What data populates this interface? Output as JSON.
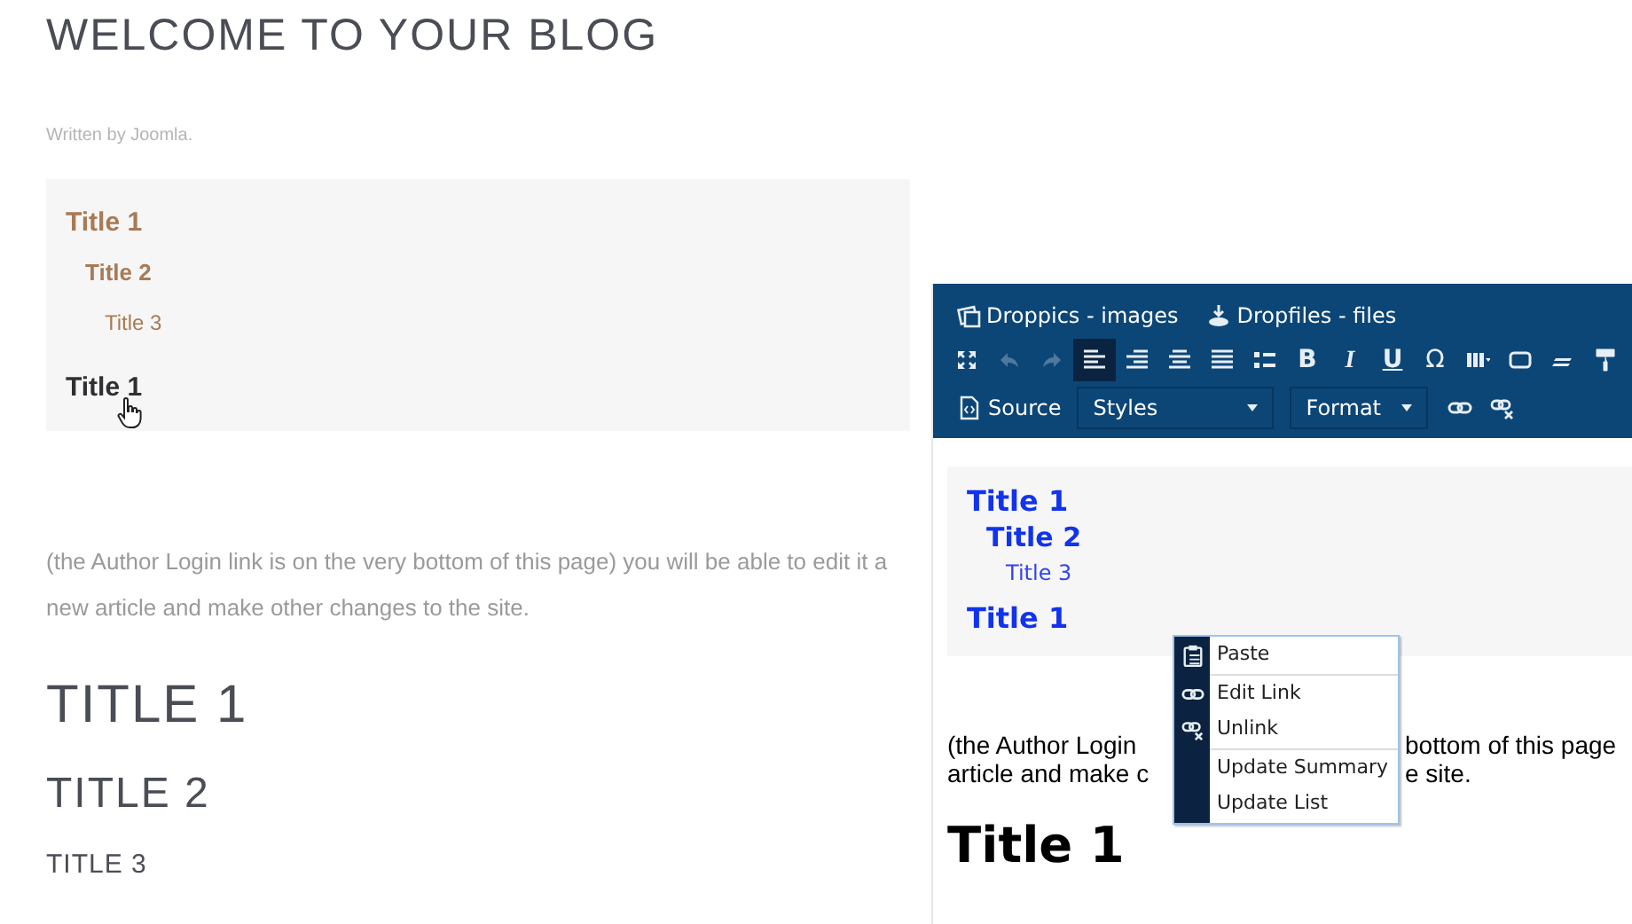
{
  "blog": {
    "title": "WELCOME TO YOUR BLOG",
    "byline": "Written by Joomla.",
    "toc": [
      {
        "text": "Title 1",
        "kind": "h1",
        "hovered": false
      },
      {
        "text": "Title 2",
        "kind": "h2",
        "hovered": false
      },
      {
        "text": "Title 3",
        "kind": "h3",
        "hovered": false
      },
      {
        "text": "Title 1",
        "kind": "h1",
        "hovered": true
      }
    ],
    "paragraph_lines": [
      "(the Author Login link is on the very bottom of this page) you will be able to edit it a",
      "new article and make other changes to the site."
    ],
    "headings": [
      {
        "text": "TITLE 1",
        "kind": "h1"
      },
      {
        "text": "TITLE 2",
        "kind": "h2"
      },
      {
        "text": "TITLE 3",
        "kind": "h3"
      }
    ]
  },
  "editor": {
    "plugins": [
      {
        "label": "Droppics - images",
        "kind": "images"
      },
      {
        "label": "Dropfiles - files",
        "kind": "files"
      }
    ],
    "toolbar": [
      {
        "kind": "fullscreen",
        "disabled": false,
        "selected": false
      },
      {
        "kind": "undo",
        "disabled": true,
        "selected": false
      },
      {
        "kind": "redo",
        "disabled": true,
        "selected": false
      },
      {
        "kind": "align-left",
        "disabled": false,
        "selected": true
      },
      {
        "kind": "align-right",
        "disabled": false,
        "selected": false
      },
      {
        "kind": "align-center",
        "disabled": false,
        "selected": false
      },
      {
        "kind": "justify",
        "disabled": false,
        "selected": false
      },
      {
        "kind": "bullet-list",
        "disabled": false,
        "selected": false
      },
      {
        "kind": "bold",
        "label": "B",
        "disabled": false,
        "selected": false
      },
      {
        "kind": "italic",
        "label": "I",
        "disabled": false,
        "selected": false
      },
      {
        "kind": "underline",
        "label": "U",
        "disabled": false,
        "selected": false
      },
      {
        "kind": "symbol",
        "label": "Ω",
        "disabled": false,
        "selected": false
      },
      {
        "kind": "table",
        "disabled": false,
        "selected": false
      },
      {
        "kind": "frame",
        "disabled": false,
        "selected": false
      },
      {
        "kind": "slash",
        "disabled": false,
        "selected": false
      },
      {
        "kind": "roller",
        "disabled": false,
        "selected": false
      }
    ],
    "source_button": {
      "label": "Source"
    },
    "dropdowns": [
      {
        "label": "Styles"
      },
      {
        "label": "Format"
      }
    ],
    "link_buttons": [
      {
        "kind": "link"
      },
      {
        "kind": "unlink"
      }
    ],
    "content": {
      "toc": [
        {
          "text": "Title 1",
          "kind": "h1"
        },
        {
          "text": "Title 2",
          "kind": "h2"
        },
        {
          "text": "Title 3",
          "kind": "h3"
        },
        {
          "text": "Title 1",
          "kind": "h1"
        }
      ],
      "paragraph_lines": [
        [
          "(the Author Login",
          "bottom of this page"
        ],
        [
          "article and make c",
          "e site."
        ]
      ],
      "heading": "Title 1"
    },
    "context_menu": [
      {
        "label": "Paste",
        "kind": "paste",
        "separator_before": false
      },
      {
        "label": "Edit Link",
        "kind": "link",
        "separator_before": true
      },
      {
        "label": "Unlink",
        "kind": "unlink",
        "separator_before": false
      },
      {
        "label": "Update Summary",
        "kind": "plain",
        "separator_before": true
      },
      {
        "label": "Update List",
        "kind": "plain",
        "separator_before": false
      }
    ]
  }
}
